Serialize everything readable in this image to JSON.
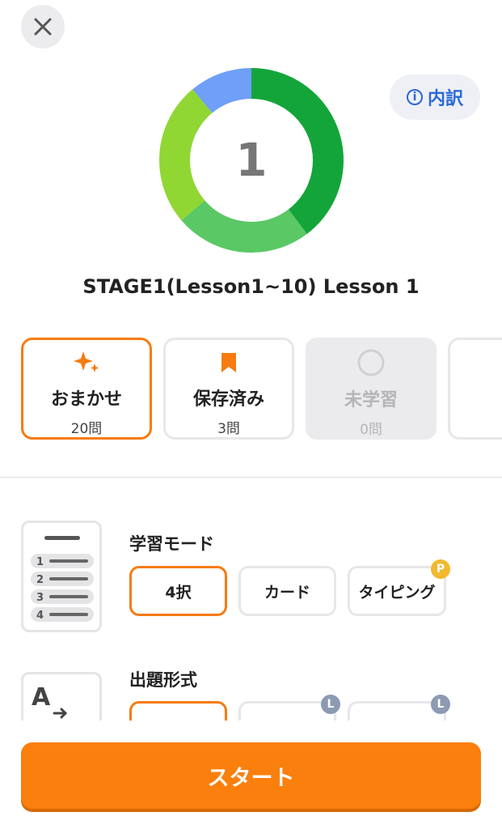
{
  "header": {
    "close_icon": "close-icon",
    "breakdown_label": "内訳",
    "breakdown_icon_glyph": "i"
  },
  "progress": {
    "center_value": "1",
    "colors": {
      "segment_dark_green": "#14a53a",
      "segment_mid_green": "#5ac865",
      "segment_light_green": "#90d733",
      "segment_blue": "#6f9ff7"
    }
  },
  "lesson": {
    "title": "STAGE1(Lesson1~10) Lesson 1"
  },
  "filters": [
    {
      "label": "おまかせ",
      "count": "20問",
      "icon": "sparkle-icon"
    },
    {
      "label": "保存済み",
      "count": "3問",
      "icon": "bookmark-icon"
    },
    {
      "label": "未学習",
      "count": "0問",
      "icon": "circle-icon"
    }
  ],
  "study_mode": {
    "label": "学習モード",
    "thumb_numbers": [
      "1",
      "2",
      "3",
      "4"
    ],
    "options": [
      {
        "label": "4択"
      },
      {
        "label": "カード"
      },
      {
        "label": "タイピング",
        "badge": "P"
      }
    ]
  },
  "question_format": {
    "label": "出題形式",
    "thumb_glyph": "A",
    "badges": [
      "L",
      "L"
    ]
  },
  "footer": {
    "start_label": "スタート"
  },
  "theme": {
    "accent_orange": "#f77b0f",
    "link_blue": "#2a67d9",
    "badge_gold": "#f2b92e",
    "badge_blue_gray": "#8c9ab4"
  }
}
